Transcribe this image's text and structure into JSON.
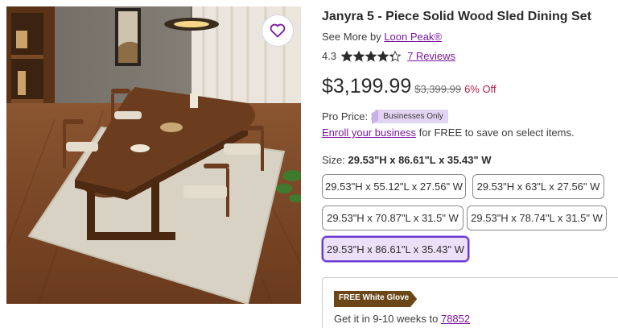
{
  "product": {
    "title": "Janyra 5 - Piece Solid Wood Sled Dining Set",
    "see_more_prefix": "See More by",
    "brand": "Loon Peak®",
    "rating": "4.3",
    "rating_value": 4.3,
    "reviews": "7 Reviews",
    "price": "$3,199.99",
    "was_price": "$3,399.99",
    "discount": "6% Off"
  },
  "pro": {
    "label": "Pro Price:",
    "amount_partial": "$",
    "badge": "Businesses Only",
    "enroll_link": "Enroll your business",
    "enroll_rest": " for FREE to save on select items."
  },
  "size": {
    "label": "Size:",
    "selected": "29.53\"H x 86.61\"L x 35.43\" W",
    "options": [
      "29.53\"H x 55.12\"L x 27.56\" W",
      "29.53\"H x 63\"L x 27.56\" W",
      "29.53\"H x 70.87\"L x 31.5\" W",
      "29.53\"H x 78.74\"L x 31.5\" W",
      "29.53\"H x 86.61\"L x 35.43\" W"
    ]
  },
  "shipping": {
    "badge": "FREE White Glove",
    "get_it_prefix": "Get it in 9-10 weeks to",
    "zip": "78852"
  },
  "colors": {
    "accent": "#7b189f",
    "selected_border": "#6a3bd1",
    "discount": "#b3204a"
  },
  "icons": {
    "favorite": "heart-icon",
    "rating": "star-icon"
  }
}
